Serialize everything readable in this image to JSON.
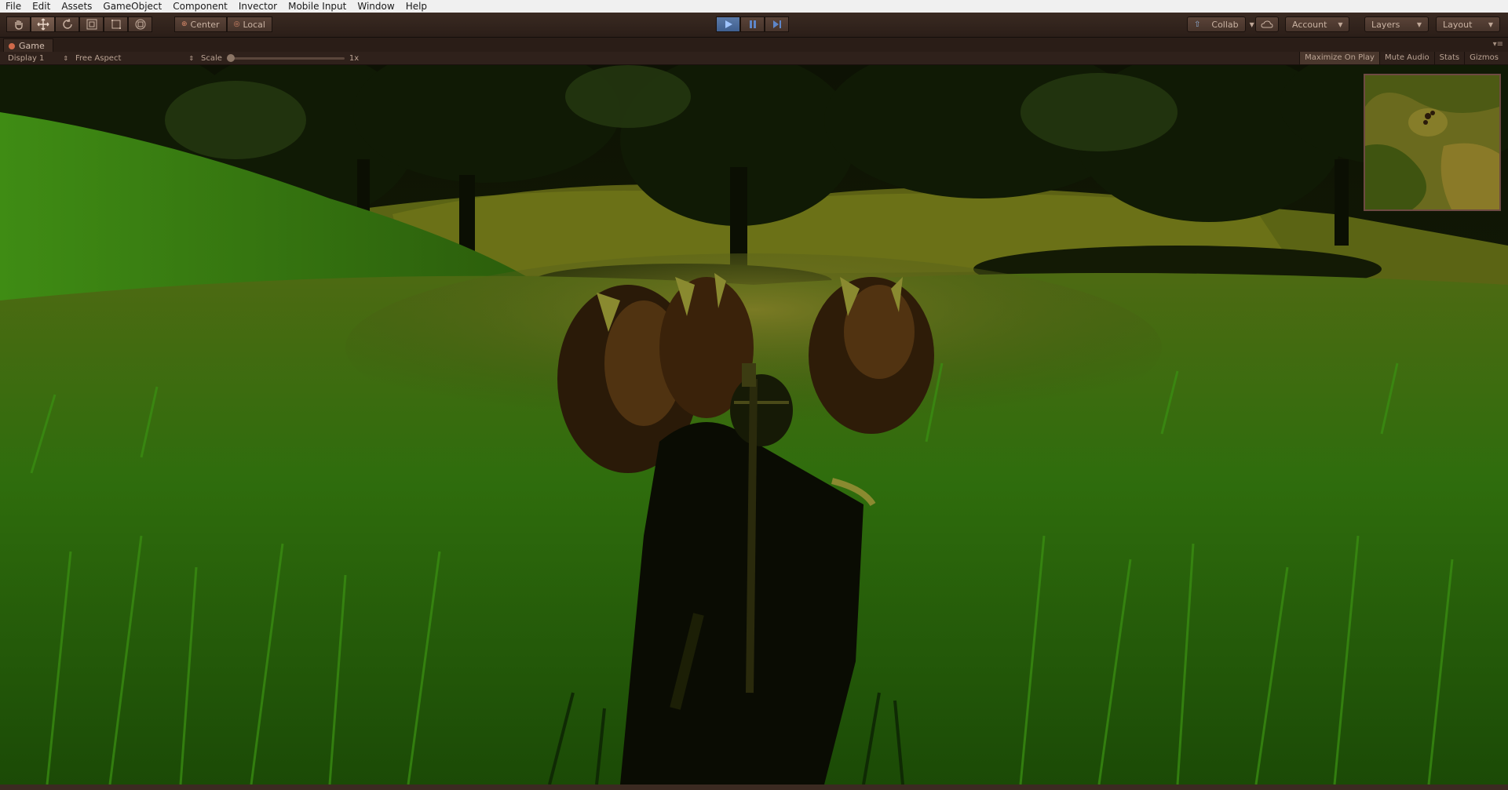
{
  "menu": [
    "File",
    "Edit",
    "Assets",
    "GameObject",
    "Component",
    "Invector",
    "Mobile Input",
    "Window",
    "Help"
  ],
  "toolbar": {
    "tools": [
      "hand-tool-icon",
      "move-tool-icon",
      "rotate-tool-icon",
      "scale-tool-icon",
      "rect-tool-icon",
      "transform-tool-icon"
    ],
    "pivot_center": "Center",
    "pivot_local": "Local",
    "collab": "Collab",
    "account": "Account",
    "layers": "Layers",
    "layout": "Layout",
    "play_active": true
  },
  "game_tab": {
    "title": "Game",
    "display": "Display 1",
    "aspect": "Free Aspect",
    "scale_label": "Scale",
    "scale_value": "1x",
    "toggles": [
      "Maximize On Play",
      "Mute Audio",
      "Stats",
      "Gizmos"
    ]
  },
  "colors": {
    "editor_dark": "#2b1e18",
    "play_blue": "#3f5f8f",
    "grass": "#2f7a0e",
    "foliage": "#2b3a10",
    "minimap_frame": "#6e4a42"
  }
}
